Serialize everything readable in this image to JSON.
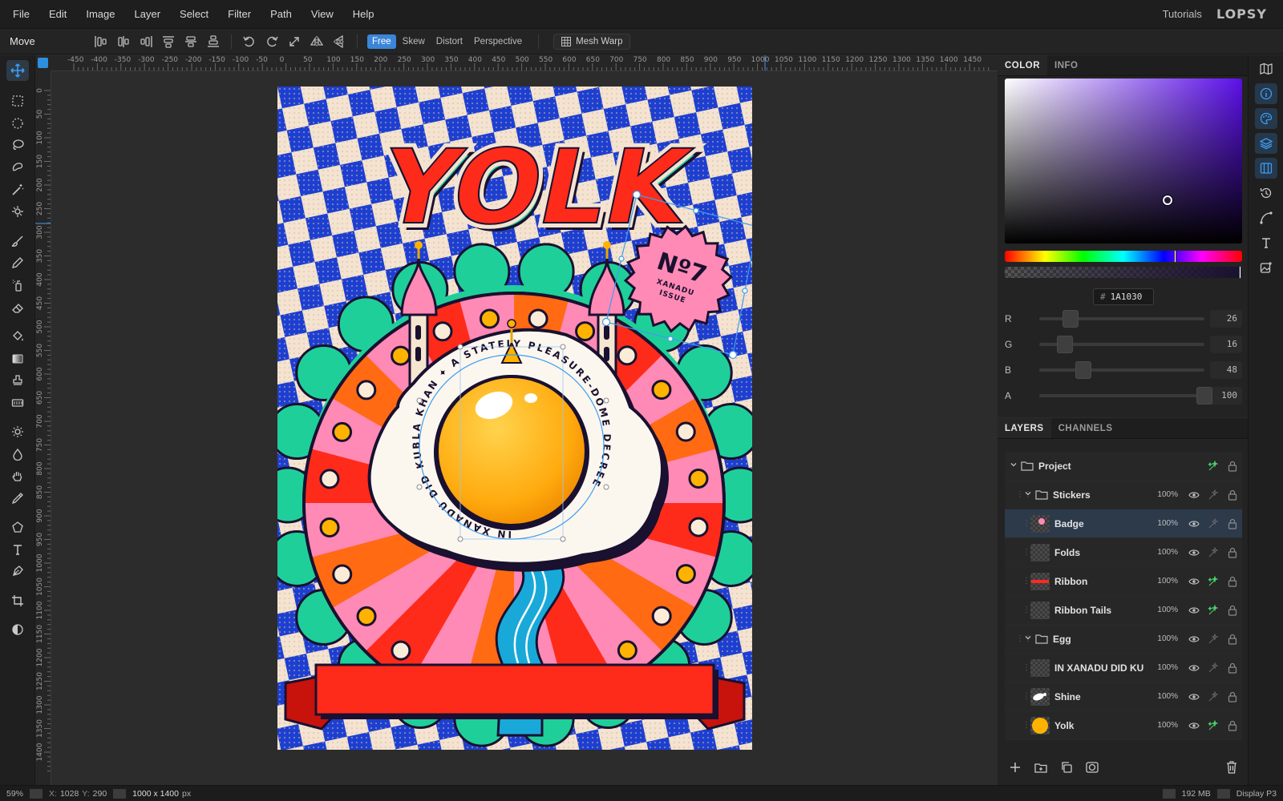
{
  "menubar": {
    "items": [
      "File",
      "Edit",
      "Image",
      "Layer",
      "Select",
      "Filter",
      "Path",
      "View",
      "Help"
    ],
    "tutorials_label": "Tutorials",
    "logo_text": "LOPSY"
  },
  "optionsbar": {
    "tool_name": "Move",
    "transform_modes": [
      "Free",
      "Skew",
      "Distort",
      "Perspective"
    ],
    "active_mode": "Free",
    "mesh_warp_label": "Mesh Warp"
  },
  "rulers": {
    "horizontal": [
      "-450",
      "-400",
      "-350",
      "-300",
      "-250",
      "-200",
      "-150",
      "-100",
      "-50",
      "0",
      "50",
      "100",
      "150",
      "200",
      "250",
      "300",
      "350",
      "400",
      "450",
      "500",
      "550",
      "600",
      "650",
      "700",
      "750",
      "800",
      "850",
      "900",
      "950",
      "1000",
      "1050",
      "1100",
      "1150",
      "1200",
      "1250",
      "1300",
      "1350",
      "1400",
      "1450"
    ],
    "vertical": [
      "0",
      "50",
      "100",
      "150",
      "200",
      "250",
      "300",
      "350",
      "400",
      "450",
      "500",
      "550",
      "600",
      "650",
      "700",
      "750",
      "800",
      "850",
      "900",
      "950",
      "1000",
      "1050",
      "1100",
      "1150",
      "1200",
      "1250",
      "1300",
      "1350",
      "1400"
    ]
  },
  "artwork": {
    "title": "YOLK",
    "badge_number": "Nº7",
    "badge_line1": "XANADU",
    "badge_line2": "ISSUE",
    "circle_text": "IN XANADU DID KUBLA KHAN ✦ A STATELY PLEASURE-DOME DECREE"
  },
  "color_panel": {
    "tabs": [
      "COLOR",
      "INFO"
    ],
    "active_tab": "COLOR",
    "hex_prefix": "#",
    "hex_value": "1A1030",
    "current_color": "#1a1030",
    "channels": [
      {
        "label": "R",
        "value": "26",
        "fraction": 0.102
      },
      {
        "label": "G",
        "value": "16",
        "fraction": 0.063
      },
      {
        "label": "B",
        "value": "48",
        "fraction": 0.188
      },
      {
        "label": "A",
        "value": "100",
        "fraction": 1.0
      }
    ]
  },
  "layers_panel": {
    "tabs": [
      "LAYERS",
      "CHANNELS"
    ],
    "active_tab": "LAYERS",
    "layers": [
      {
        "name": "Project",
        "type": "group",
        "depth": 0,
        "opacity": "",
        "selected": false,
        "effects": true
      },
      {
        "name": "Stickers",
        "type": "group",
        "depth": 1,
        "opacity": "100%",
        "selected": false,
        "effects": false
      },
      {
        "name": "Badge",
        "type": "layer",
        "depth": 2,
        "opacity": "100%",
        "selected": true,
        "effects": false
      },
      {
        "name": "Folds",
        "type": "layer",
        "depth": 2,
        "opacity": "100%",
        "selected": false,
        "effects": false
      },
      {
        "name": "Ribbon",
        "type": "layer",
        "depth": 2,
        "opacity": "100%",
        "selected": false,
        "effects": true
      },
      {
        "name": "Ribbon Tails",
        "type": "layer",
        "depth": 2,
        "opacity": "100%",
        "selected": false,
        "effects": true
      },
      {
        "name": "Egg",
        "type": "group",
        "depth": 1,
        "opacity": "100%",
        "selected": false,
        "effects": false
      },
      {
        "name": "IN XANADU DID KU",
        "type": "layer",
        "depth": 2,
        "opacity": "100%",
        "selected": false,
        "effects": false
      },
      {
        "name": "Shine",
        "type": "layer",
        "depth": 2,
        "opacity": "100%",
        "selected": false,
        "effects": false
      },
      {
        "name": "Yolk",
        "type": "layer",
        "depth": 2,
        "opacity": "100%",
        "selected": false,
        "effects": true
      }
    ]
  },
  "statusbar": {
    "zoom": "59%",
    "cursor_x_label": "X:",
    "cursor_x": "1028",
    "cursor_y_label": "Y:",
    "cursor_y": "290",
    "doc_size": "1000 x 1400",
    "doc_unit": "px",
    "memory": "192 MB",
    "color_profile": "Display P3"
  }
}
